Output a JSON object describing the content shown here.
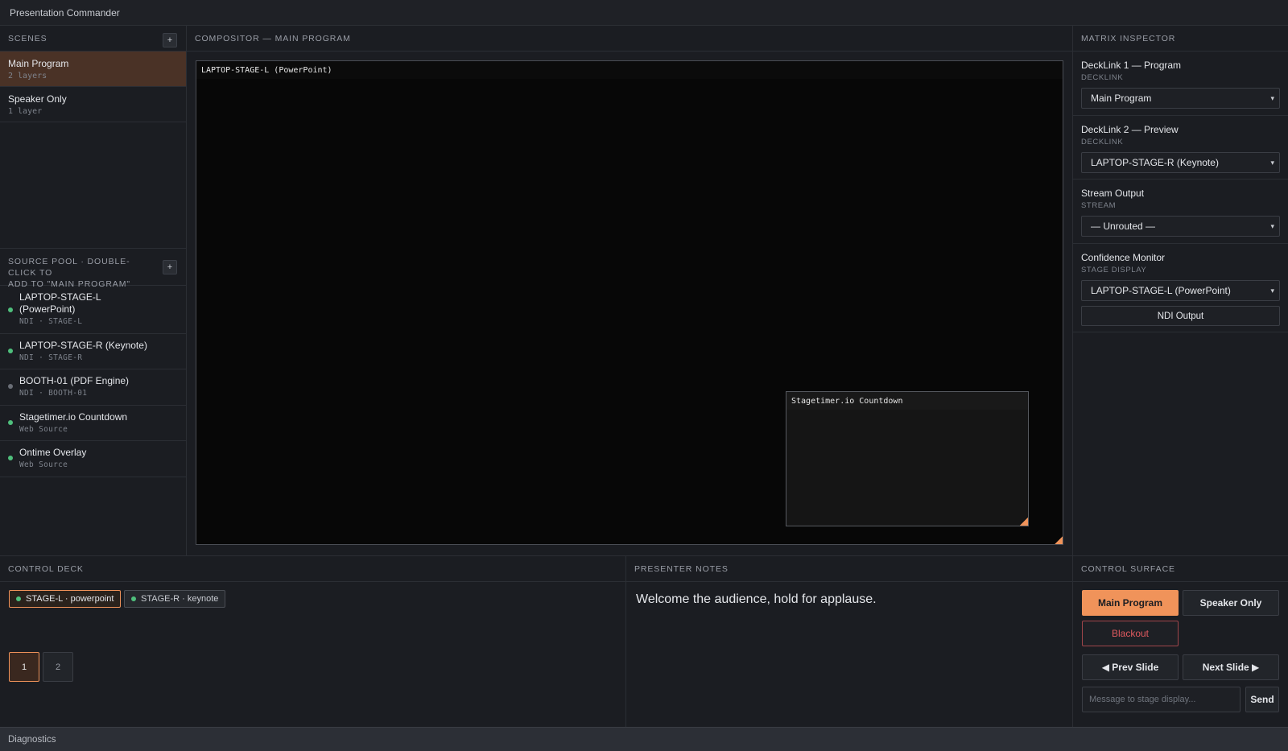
{
  "app": {
    "title": "Presentation Commander"
  },
  "scenes": {
    "header": "SCENES",
    "add_label": "+",
    "items": [
      {
        "name": "Main Program",
        "layers": "2 layers",
        "active": true
      },
      {
        "name": "Speaker Only",
        "layers": "1 layer",
        "active": false
      }
    ]
  },
  "source_pool": {
    "header_line1": "SOURCE POOL · DOUBLE-CLICK TO",
    "header_line2": "ADD TO \"MAIN PROGRAM\"",
    "add_label": "+",
    "items": [
      {
        "name_line1": "LAPTOP-STAGE-L",
        "name_line2": "(PowerPoint)",
        "meta": "NDI · STAGE-L",
        "status": "online"
      },
      {
        "name_line1": "LAPTOP-STAGE-R (Keynote)",
        "meta": "NDI · STAGE-R",
        "status": "online"
      },
      {
        "name_line1": "BOOTH-01 (PDF Engine)",
        "meta": "NDI · BOOTH-01",
        "status": "offline"
      },
      {
        "name_line1": "Stagetimer.io Countdown",
        "meta": "Web Source",
        "status": "online"
      },
      {
        "name_line1": "Ontime Overlay",
        "meta": "Web Source",
        "status": "online"
      }
    ]
  },
  "compositor": {
    "header": "COMPOSITOR — MAIN PROGRAM",
    "base_layer": "LAPTOP-STAGE-L (PowerPoint)",
    "overlay_layer": "Stagetimer.io Countdown"
  },
  "matrix": {
    "header": "MATRIX INSPECTOR",
    "outputs": [
      {
        "name": "DeckLink 1 — Program",
        "type": "DECKLINK",
        "selected": "Main Program"
      },
      {
        "name": "DeckLink 2 — Preview",
        "type": "DECKLINK",
        "selected": "LAPTOP-STAGE-R (Keynote)"
      },
      {
        "name": "Stream Output",
        "type": "STREAM",
        "selected": "— Unrouted —"
      },
      {
        "name": "Confidence Monitor",
        "type": "STAGE DISPLAY",
        "selected": "LAPTOP-STAGE-L (PowerPoint)"
      }
    ],
    "ndi_button": "NDI Output"
  },
  "control_deck": {
    "header": "CONTROL DECK",
    "chips": [
      {
        "label": "STAGE-L · powerpoint",
        "active": true
      },
      {
        "label": "STAGE-R · keynote",
        "active": false
      }
    ],
    "pages": [
      "1",
      "2"
    ]
  },
  "presenter_notes": {
    "header": "PRESENTER NOTES",
    "text": "Welcome the audience, hold for applause."
  },
  "control_surface": {
    "header": "CONTROL SURFACE",
    "main_program": "Main Program",
    "speaker_only": "Speaker Only",
    "blackout": "Blackout",
    "prev_slide": "◀ Prev Slide",
    "next_slide": "Next Slide ▶",
    "message_placeholder": "Message to stage display...",
    "send": "Send"
  },
  "diagnostics": {
    "label": "Diagnostics"
  },
  "colors": {
    "accent": "#f0935a",
    "online": "#4fbf7c",
    "offline": "#6a6e76",
    "danger": "#e05a5f"
  }
}
